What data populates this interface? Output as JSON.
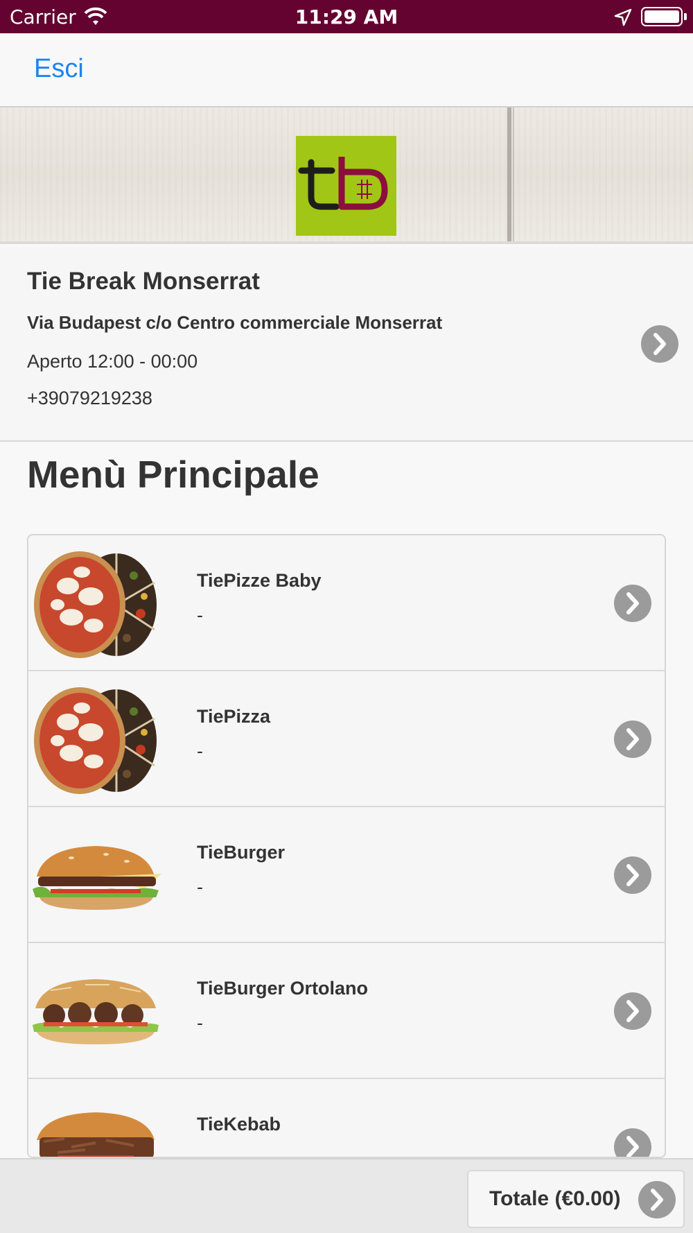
{
  "status_bar": {
    "carrier": "Carrier",
    "time": "11:29 AM"
  },
  "nav": {
    "exit_label": "Esci"
  },
  "colors": {
    "status_bar": "#640330",
    "link": "#1b84f0",
    "logo_bg": "#a2c615",
    "logo_accent": "#8a0f3c"
  },
  "store": {
    "name": "Tie Break Monserrat",
    "address": "Via Budapest c/o Centro commerciale Monserrat",
    "hours": "Aperto 12:00 - 00:00",
    "phone": "+39079219238"
  },
  "menu": {
    "title": "Menù Principale",
    "items": [
      {
        "title": "TiePizze Baby",
        "desc": "-",
        "image": "pizza-image"
      },
      {
        "title": "TiePizza",
        "desc": "-",
        "image": "pizza-image"
      },
      {
        "title": "TieBurger",
        "desc": "-",
        "image": "burger-image"
      },
      {
        "title": "TieBurger Ortolano",
        "desc": "-",
        "image": "veggie-burger-image"
      },
      {
        "title": "TieKebab",
        "desc": "-",
        "image": "kebab-image"
      }
    ]
  },
  "footer": {
    "total_label": "Totale (€0.00)"
  }
}
